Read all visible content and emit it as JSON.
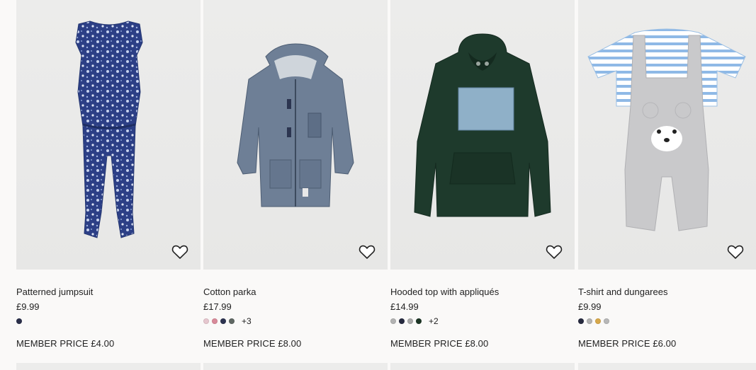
{
  "products": [
    {
      "title": "Patterned jumpsuit",
      "price": "£9.99",
      "member_price": "MEMBER PRICE £4.00",
      "swatches": [
        "#2a2f4a"
      ],
      "more_colors": "",
      "image": "patterned-jumpsuit-image"
    },
    {
      "title": "Cotton parka",
      "price": "£17.99",
      "member_price": "MEMBER PRICE £8.00",
      "swatches": [
        "#e6c7cf",
        "#d98a9a",
        "#2d3350",
        "#5f6763"
      ],
      "more_colors": "+3",
      "image": "cotton-parka-image"
    },
    {
      "title": "Hooded top with appliqués",
      "price": "£14.99",
      "member_price": "MEMBER PRICE £8.00",
      "swatches": [
        "#b3b3b3",
        "#262a3f",
        "#a9a9a9",
        "#1c3524"
      ],
      "more_colors": "+2",
      "image": "hooded-top-image"
    },
    {
      "title": "T-shirt and dungarees",
      "price": "£9.99",
      "member_price": "MEMBER PRICE £6.00",
      "swatches": [
        "#262a3f",
        "#b3b3b3",
        "#d7a84a",
        "#b8b8b8"
      ],
      "more_colors": "",
      "image": "tshirt-dungarees-image"
    }
  ],
  "colors": {
    "page_bg": "#faf9f8",
    "photo_bg": "#ececeb",
    "text": "#222222"
  },
  "icons": {
    "favorite": "heart-outline-icon"
  }
}
